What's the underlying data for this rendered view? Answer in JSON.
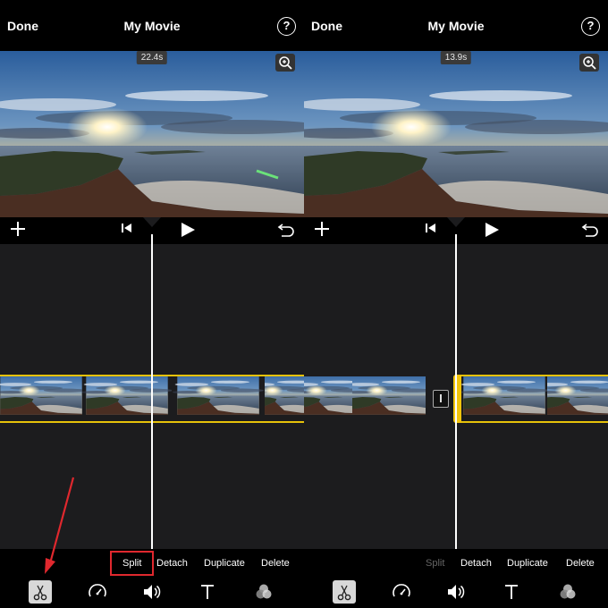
{
  "panels": [
    {
      "done_label": "Done",
      "title": "My Movie",
      "help_label": "?",
      "timecode": "22.4s",
      "actions": [
        {
          "label": "Split",
          "enabled": true,
          "highlighted": true
        },
        {
          "label": "Detach",
          "enabled": true
        },
        {
          "label": "Duplicate",
          "enabled": true
        },
        {
          "label": "Delete",
          "enabled": true
        }
      ],
      "tools": [
        "scissors-icon",
        "speed-icon",
        "volume-icon",
        "text-icon",
        "filters-icon"
      ],
      "active_tool": "scissors-icon"
    },
    {
      "done_label": "Done",
      "title": "My Movie",
      "help_label": "?",
      "timecode": "13.9s",
      "actions": [
        {
          "label": "Split",
          "enabled": false
        },
        {
          "label": "Detach",
          "enabled": true
        },
        {
          "label": "Duplicate",
          "enabled": true
        },
        {
          "label": "Delete",
          "enabled": true
        }
      ],
      "tools": [
        "scissors-icon",
        "speed-icon",
        "volume-icon",
        "text-icon",
        "filters-icon"
      ],
      "active_tool": "scissors-icon"
    }
  ],
  "colors": {
    "selection_yellow": "#e6c20a",
    "highlight_red": "#e0282e",
    "timeline_bg": "#1c1c1e"
  }
}
